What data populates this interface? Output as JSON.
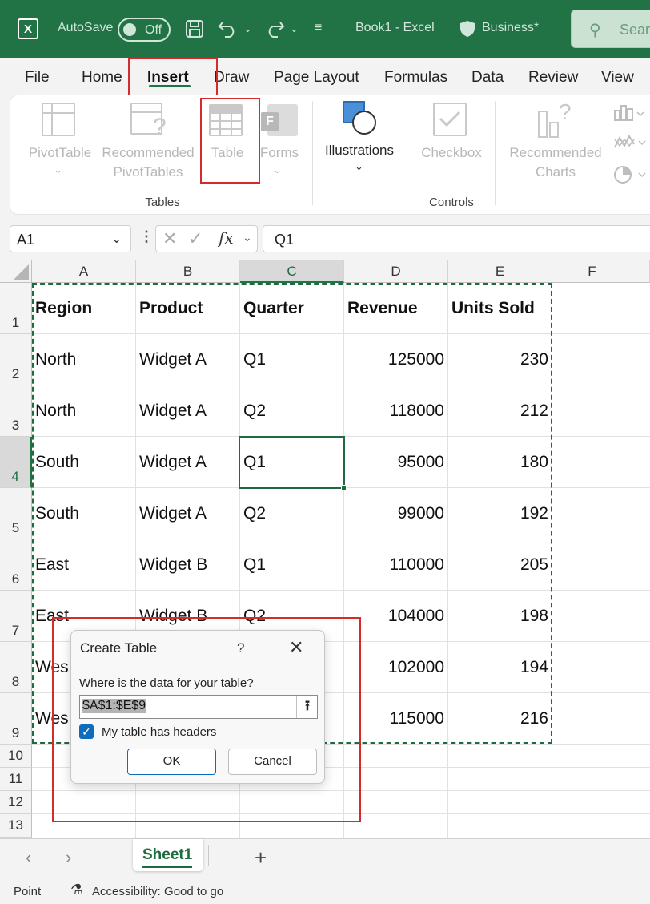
{
  "titlebar": {
    "app_letter": "X",
    "autosave_label": "AutoSave",
    "autosave_state": "Off",
    "doc_title": "Book1  -  Excel",
    "sensitivity": "Business*",
    "search_placeholder": "Sear"
  },
  "menu": {
    "file": "File",
    "home": "Home",
    "insert": "Insert",
    "draw": "Draw",
    "page_layout": "Page Layout",
    "formulas": "Formulas",
    "data": "Data",
    "review": "Review",
    "view": "View"
  },
  "ribbon": {
    "pivottable": "PivotTable",
    "recommended_1": "Recommended",
    "pivottables": "PivotTables",
    "table": "Table",
    "forms": "Forms",
    "illustrations": "Illustrations",
    "checkbox": "Checkbox",
    "rec_charts_1": "Recommended",
    "rec_charts_2": "Charts",
    "group_tables": "Tables",
    "group_controls": "Controls"
  },
  "formula_bar": {
    "name_box": "A1",
    "fx": "fx",
    "value": "Q1"
  },
  "grid": {
    "columns": [
      "A",
      "B",
      "C",
      "D",
      "E",
      "F"
    ],
    "rows": [
      "1",
      "2",
      "3",
      "4",
      "5",
      "6",
      "7",
      "8",
      "9",
      "10",
      "11",
      "12",
      "13"
    ],
    "headers": [
      "Region",
      "Product",
      "Quarter",
      "Revenue",
      "Units Sold"
    ],
    "data": [
      [
        "North",
        "Widget A",
        "Q1",
        "125000",
        "230"
      ],
      [
        "North",
        "Widget A",
        "Q2",
        "118000",
        "212"
      ],
      [
        "South",
        "Widget A",
        "Q1",
        "95000",
        "180"
      ],
      [
        "South",
        "Widget A",
        "Q2",
        "99000",
        "192"
      ],
      [
        "East",
        "Widget B",
        "Q1",
        "110000",
        "205"
      ],
      [
        "East",
        "Widget B",
        "Q2",
        "104000",
        "198"
      ],
      [
        "Wes",
        "",
        "",
        "102000",
        "194"
      ],
      [
        "Wes",
        "",
        "",
        "115000",
        "216"
      ]
    ]
  },
  "dialog": {
    "title": "Create Table",
    "help": "?",
    "prompt": "Where is the data for your table?",
    "range": "$A$1:$E$9",
    "headers_label": "My table has headers",
    "ok": "OK",
    "cancel": "Cancel"
  },
  "sheet_tabs": {
    "active": "Sheet1",
    "add": "+"
  },
  "status": {
    "mode": "Point",
    "accessibility": "Accessibility: Good to go"
  },
  "colors": {
    "excel_green": "#217346",
    "highlight_red": "#d52b2b",
    "selection_green": "#1e6b40",
    "checkbox_blue": "#0f6cbd"
  }
}
